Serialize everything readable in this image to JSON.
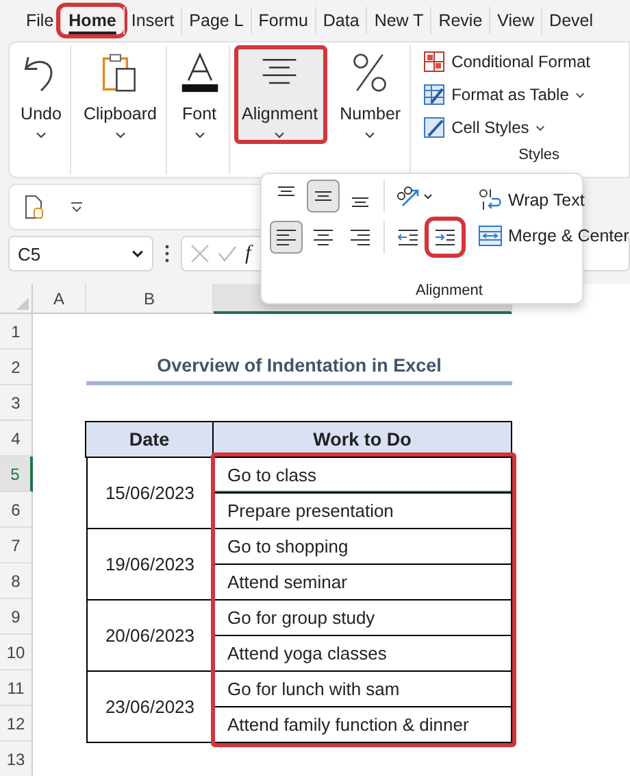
{
  "tabs": [
    {
      "label": "File",
      "selected": false,
      "highlighted": false
    },
    {
      "label": "Home",
      "selected": true,
      "highlighted": true
    },
    {
      "label": "Insert",
      "selected": false,
      "highlighted": false
    },
    {
      "label": "Page L",
      "selected": false,
      "highlighted": false
    },
    {
      "label": "Formu",
      "selected": false,
      "highlighted": false
    },
    {
      "label": "Data",
      "selected": false,
      "highlighted": false
    },
    {
      "label": "New T",
      "selected": false,
      "highlighted": false
    },
    {
      "label": "Revie",
      "selected": false,
      "highlighted": false
    },
    {
      "label": "View",
      "selected": false,
      "highlighted": false
    },
    {
      "label": "Devel",
      "selected": false,
      "highlighted": false
    }
  ],
  "ribbon_groups": [
    {
      "kind": "undo",
      "label": "Undo",
      "selected": false,
      "highlighted": false
    },
    {
      "kind": "clipboard",
      "label": "Clipboard",
      "selected": false,
      "highlighted": false
    },
    {
      "kind": "font",
      "label": "Font",
      "selected": false,
      "highlighted": false
    },
    {
      "kind": "alignment",
      "label": "Alignment",
      "selected": true,
      "highlighted": true
    },
    {
      "kind": "number",
      "label": "Number",
      "selected": false,
      "highlighted": false
    }
  ],
  "styles_group": {
    "label": "Styles",
    "items": [
      {
        "kind": "conditional",
        "label": "Conditional Format",
        "dropdown": false
      },
      {
        "kind": "table",
        "label": "Format as Table",
        "dropdown": true
      },
      {
        "kind": "cellstyles",
        "label": "Cell Styles",
        "dropdown": true
      }
    ]
  },
  "alignment_panel": {
    "label": "Alignment",
    "rows": [
      [
        {
          "kind": "top",
          "selected": false,
          "highlighted": false
        },
        {
          "kind": "middle",
          "selected": true,
          "highlighted": false
        },
        {
          "kind": "bottom",
          "selected": false,
          "highlighted": false
        },
        {
          "kind": "orientation",
          "selected": false,
          "highlighted": false
        }
      ],
      [
        {
          "kind": "left",
          "selected": true,
          "highlighted": false
        },
        {
          "kind": "center",
          "selected": false,
          "highlighted": false
        },
        {
          "kind": "right",
          "selected": false,
          "highlighted": false
        },
        {
          "kind": "decrease",
          "selected": false,
          "highlighted": false
        },
        {
          "kind": "increase",
          "selected": false,
          "highlighted": true
        }
      ]
    ],
    "wrap_text": "Wrap Text",
    "merge": "Merge & Center"
  },
  "name_box": "C5",
  "function_label": "f",
  "column_headers": [
    "A",
    "B"
  ],
  "row_numbers": [
    "1",
    "2",
    "3",
    "4",
    "5",
    "6",
    "7",
    "8",
    "9",
    "10",
    "11",
    "12",
    "13"
  ],
  "sheet": {
    "title": "Overview of Indentation in Excel",
    "columns": [
      "Date",
      "Work to Do"
    ],
    "highlight_tasks": true,
    "groups": [
      {
        "date": "15/06/2023",
        "tasks": [
          {
            "text": "Go to class",
            "selected": true
          },
          {
            "text": "Prepare presentation",
            "selected": false
          }
        ]
      },
      {
        "date": "19/06/2023",
        "tasks": [
          {
            "text": "Go to shopping",
            "selected": false
          },
          {
            "text": "Attend seminar",
            "selected": false
          }
        ]
      },
      {
        "date": "20/06/2023",
        "tasks": [
          {
            "text": "Go for group study",
            "selected": false
          },
          {
            "text": "Attend yoga classes",
            "selected": false
          }
        ]
      },
      {
        "date": "23/06/2023",
        "tasks": [
          {
            "text": "Go for lunch with sam",
            "selected": false
          },
          {
            "text": "Attend family function & dinner",
            "selected": false
          }
        ]
      }
    ]
  }
}
